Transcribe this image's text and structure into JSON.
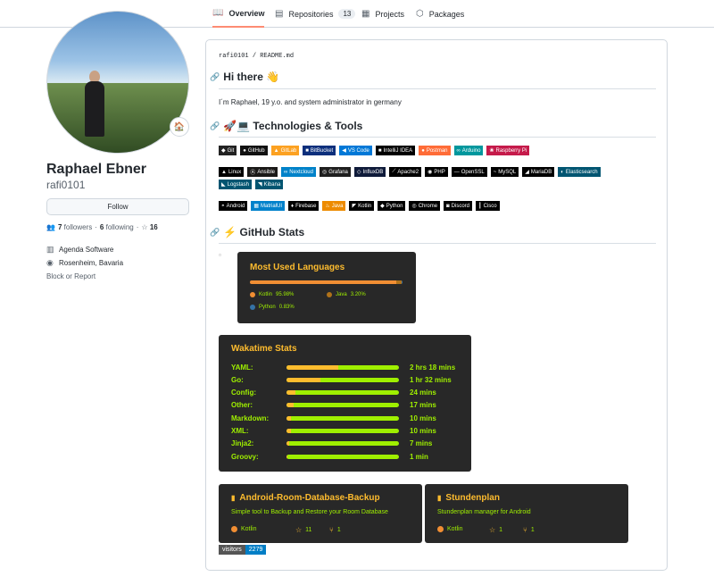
{
  "tabs": [
    {
      "label": "Overview",
      "icon": "book-icon",
      "active": true
    },
    {
      "label": "Repositories",
      "icon": "repo-icon",
      "count": "13"
    },
    {
      "label": "Projects",
      "icon": "project-icon"
    },
    {
      "label": "Packages",
      "icon": "package-icon"
    }
  ],
  "profile": {
    "status_emoji": "🏠",
    "name": "Raphael Ebner",
    "login": "rafi0101",
    "follow_label": "Follow",
    "followers_count": "7",
    "followers_label": "followers",
    "following_count": "6",
    "following_label": "following",
    "stars_count": "16",
    "company": "Agenda Software",
    "location": "Rosenheim, Bavaria",
    "block_label": "Block or Report"
  },
  "readme": {
    "path_user": "rafi0101",
    "path_sep": "/",
    "path_file": "README.md",
    "heading1": "Hi there 👋",
    "intro": "I´m Raphael, 19 y.o. and system administrator in germany",
    "heading2": "🚀💻 Technologies & Tools",
    "badges_row1": [
      {
        "label": "Git",
        "color": "#222222",
        "icon": "git-icon",
        "glyph": "◆"
      },
      {
        "label": "GitHub",
        "color": "#111111",
        "icon": "github-icon",
        "glyph": "●"
      },
      {
        "label": "GitLab",
        "color": "#fca121",
        "icon": "gitlab-icon",
        "glyph": "▲"
      },
      {
        "label": "BitBucket",
        "color": "#0c2f7c",
        "icon": "bitbucket-icon",
        "glyph": "■"
      },
      {
        "label": "VS Code",
        "color": "#0078d7",
        "icon": "vscode-icon",
        "glyph": "◀"
      },
      {
        "label": "IntelliJ IDEA",
        "color": "#000000",
        "icon": "intellij-icon",
        "glyph": "■"
      },
      {
        "label": "Postman",
        "color": "#ff6c37",
        "icon": "postman-icon",
        "glyph": "●"
      },
      {
        "label": "Arduino",
        "color": "#00979d",
        "icon": "arduino-icon",
        "glyph": "∞"
      },
      {
        "label": "Raspberry Pi",
        "color": "#c51a4a",
        "icon": "raspberry-icon",
        "glyph": "❀"
      }
    ],
    "badges_row2": [
      {
        "label": "Linux",
        "color": "#000000",
        "icon": "linux-icon",
        "glyph": "▲"
      },
      {
        "label": "Ansible",
        "color": "#1a1918",
        "icon": "ansible-icon",
        "glyph": "Ⓐ"
      },
      {
        "label": "Nextcloud",
        "color": "#0082c9",
        "icon": "nextcloud-icon",
        "glyph": "∞"
      },
      {
        "label": "Grafana",
        "color": "#1f1f1f",
        "icon": "grafana-icon",
        "glyph": "◎"
      },
      {
        "label": "InfluxDB",
        "color": "#0f1b3a",
        "icon": "influxdb-icon",
        "glyph": "◇"
      },
      {
        "label": "Apache2",
        "color": "#000000",
        "icon": "apache-icon",
        "glyph": "⟋"
      },
      {
        "label": "PHP",
        "color": "#000000",
        "icon": "php-icon",
        "glyph": "◉"
      },
      {
        "label": "OpenSSL",
        "color": "#000000",
        "icon": "openssl-icon",
        "glyph": "—"
      },
      {
        "label": "MySQL",
        "color": "#000000",
        "icon": "mysql-icon",
        "glyph": "~"
      },
      {
        "label": "MariaDB",
        "color": "#000000",
        "icon": "mariadb-icon",
        "glyph": "◢"
      },
      {
        "label": "Elasticsearch",
        "color": "#005571",
        "icon": "elasticsearch-icon",
        "glyph": "◐"
      }
    ],
    "badges_row3": [
      {
        "label": "Logstash",
        "color": "#005571",
        "icon": "logstash-icon",
        "glyph": "◣"
      },
      {
        "label": "Kibana",
        "color": "#005571",
        "icon": "kibana-icon",
        "glyph": "◥"
      }
    ],
    "badges_row4": [
      {
        "label": "Android",
        "color": "#000000",
        "icon": "android-icon",
        "glyph": "◓"
      },
      {
        "label": "MatrialUI",
        "color": "#0081cb",
        "icon": "materialui-icon",
        "glyph": "▦"
      },
      {
        "label": "Firebase",
        "color": "#000000",
        "icon": "firebase-icon",
        "glyph": "♦"
      },
      {
        "label": "Java",
        "color": "#ed8b00",
        "icon": "java-icon",
        "glyph": "♨"
      },
      {
        "label": "Kotlin",
        "color": "#000000",
        "icon": "kotlin-icon",
        "glyph": "◤"
      },
      {
        "label": "Python",
        "color": "#000000",
        "icon": "python-icon",
        "glyph": "◆"
      },
      {
        "label": "Chrome",
        "color": "#000000",
        "icon": "chrome-icon",
        "glyph": "◎"
      },
      {
        "label": "Discord",
        "color": "#000000",
        "icon": "discord-icon",
        "glyph": "◙"
      },
      {
        "label": "Cisco",
        "color": "#000000",
        "icon": "cisco-icon",
        "glyph": "┃"
      }
    ],
    "heading3": "⚡ GitHub Stats",
    "languages": {
      "title": "Most Used Languages",
      "items": [
        {
          "name": "Kotlin",
          "percent": "95.98%",
          "share": 95.98,
          "color": "#f18e33"
        },
        {
          "name": "Java",
          "percent": "3.20%",
          "share": 3.2,
          "color": "#b07219"
        },
        {
          "name": "Python",
          "percent": "0.83%",
          "share": 0.83,
          "color": "#3572a5"
        }
      ]
    },
    "wakatime": {
      "title": "Wakatime Stats",
      "rows": [
        {
          "lang": "YAML:",
          "time": "2 hrs 18 mins",
          "share": 0.46
        },
        {
          "lang": "Go:",
          "time": "1 hr 32 mins",
          "share": 0.3
        },
        {
          "lang": "Config:",
          "time": "24 mins",
          "share": 0.08
        },
        {
          "lang": "Other:",
          "time": "17 mins",
          "share": 0.06
        },
        {
          "lang": "Markdown:",
          "time": "10 mins",
          "share": 0.04
        },
        {
          "lang": "XML:",
          "time": "10 mins",
          "share": 0.04
        },
        {
          "lang": "Jinja2:",
          "time": "7 mins",
          "share": 0.02
        },
        {
          "lang": "Groovy:",
          "time": "1 min",
          "share": 0.003
        }
      ]
    },
    "pinned": [
      {
        "name": "Android-Room-Database-Backup",
        "desc": "Simple tool to Backup and Restore your Room Database",
        "lang": "Kotlin",
        "stars": "11",
        "forks": "1"
      },
      {
        "name": "Stundenplan",
        "desc": "Stundenplan manager for Android",
        "lang": "Kotlin",
        "stars": "1",
        "forks": "1"
      }
    ],
    "visitors_label": "visitors",
    "visitors_count": "2279"
  }
}
